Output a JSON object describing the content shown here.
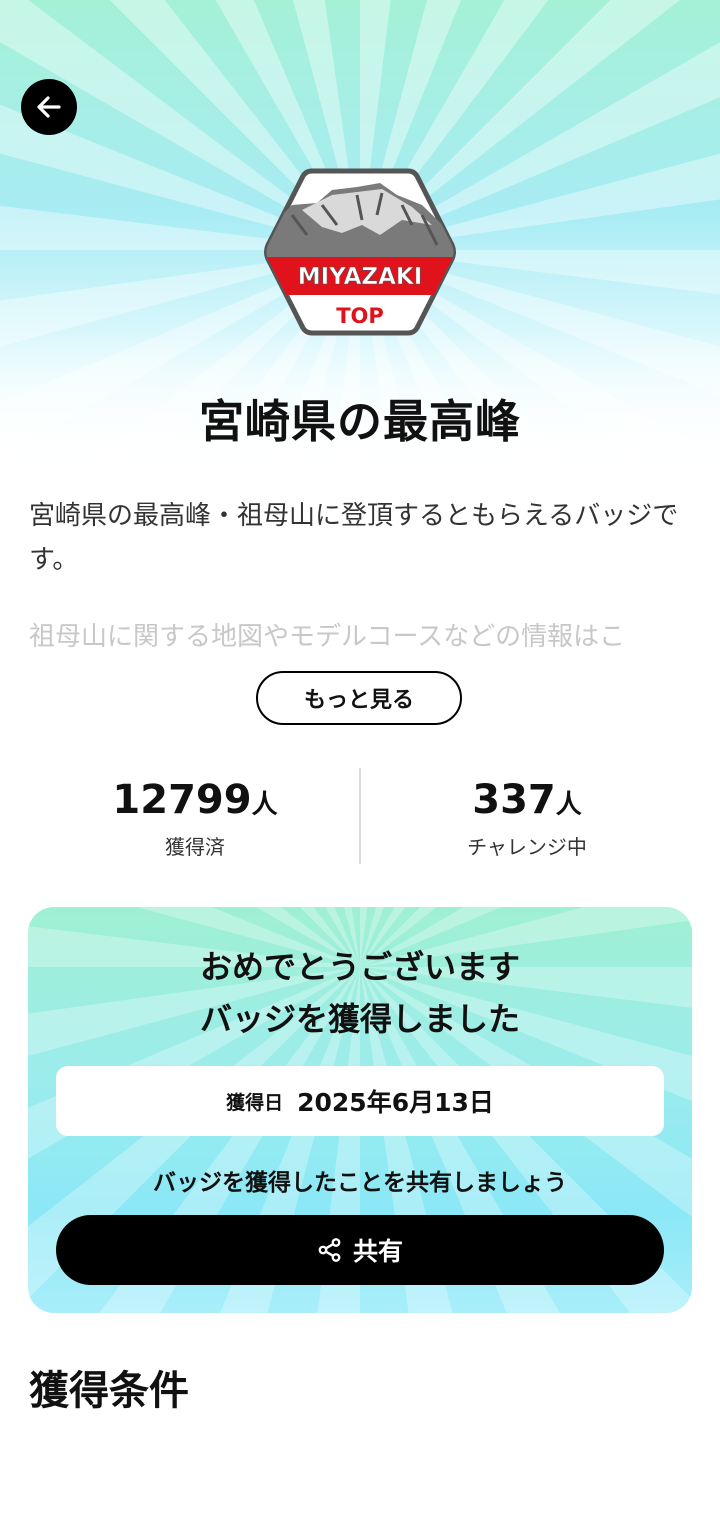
{
  "navigation": {
    "back_icon": "arrow-left-icon"
  },
  "badge": {
    "line1": "MIYAZAKI",
    "line2": "TOP",
    "accent_color": "#e0121b",
    "frame_color": "#555555"
  },
  "page_title": "宮崎県の最高峰",
  "description": {
    "text": "宮崎県の最高峰・祖母山に登頂するともらえるバッジです。",
    "faded_text": "祖母山に関する地図やモデルコースなどの情報はこ"
  },
  "more_button_label": "もっと見る",
  "stats": {
    "acquired": {
      "value": "12799",
      "unit": "人",
      "label": "獲得済"
    },
    "challenging": {
      "value": "337",
      "unit": "人",
      "label": "チャレンジ中"
    }
  },
  "congrats_card": {
    "line1": "おめでとうございます",
    "line2": "バッジを獲得しました",
    "date_label": "獲得日",
    "date_value": "2025年6月13日",
    "share_prompt": "バッジを獲得したことを共有しましょう",
    "share_button_label": "共有",
    "share_icon": "share-icon"
  },
  "conditions_title": "獲得条件"
}
